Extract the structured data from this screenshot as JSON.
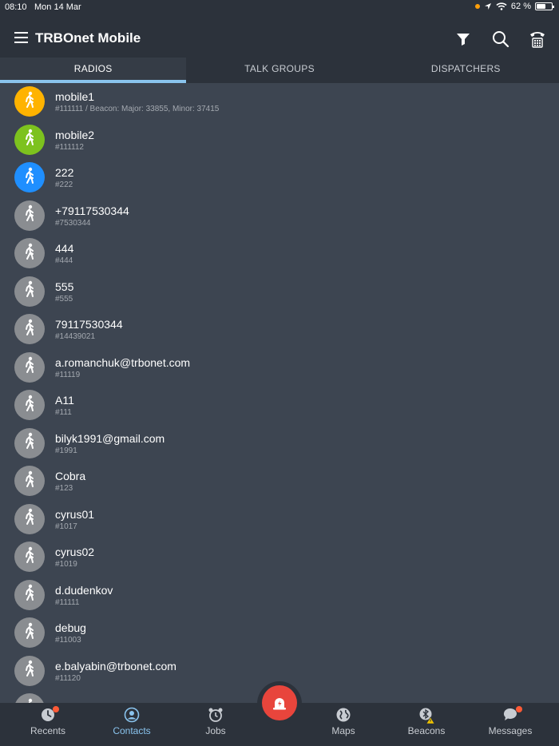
{
  "status_bar": {
    "time": "08:10",
    "date": "Mon 14 Mar",
    "battery": "62 %",
    "battery_level": 0.62
  },
  "header": {
    "title": "TRBOnet Mobile",
    "icons": [
      "menu-icon",
      "filter-icon",
      "search-icon",
      "phone-icon"
    ]
  },
  "tabs": [
    {
      "label": "RADIOS",
      "active": true
    },
    {
      "label": "TALK GROUPS",
      "active": false
    },
    {
      "label": "DISPATCHERS",
      "active": false
    }
  ],
  "radios": [
    {
      "name": "mobile1",
      "sub": "#111111 / Beacon: Major: 33855, Minor: 37415",
      "color": "#ffb300"
    },
    {
      "name": "mobile2",
      "sub": "#111112",
      "color": "#7dc21e"
    },
    {
      "name": "222",
      "sub": "#222",
      "color": "#1f8fff"
    },
    {
      "name": "+79117530344",
      "sub": "#7530344",
      "color": "#8a8d91"
    },
    {
      "name": "444",
      "sub": "#444",
      "color": "#8a8d91"
    },
    {
      "name": "555",
      "sub": "#555",
      "color": "#8a8d91"
    },
    {
      "name": "79117530344",
      "sub": "#14439021",
      "color": "#8a8d91"
    },
    {
      "name": "a.romanchuk@trbonet.com",
      "sub": "#11119",
      "color": "#8a8d91"
    },
    {
      "name": "A11",
      "sub": "#111",
      "color": "#8a8d91"
    },
    {
      "name": "bilyk1991@gmail.com",
      "sub": "#1991",
      "color": "#8a8d91"
    },
    {
      "name": "Cobra",
      "sub": "#123",
      "color": "#8a8d91"
    },
    {
      "name": "cyrus01",
      "sub": "#1017",
      "color": "#8a8d91"
    },
    {
      "name": "cyrus02",
      "sub": "#1019",
      "color": "#8a8d91"
    },
    {
      "name": "d.dudenkov",
      "sub": "#11111",
      "color": "#8a8d91"
    },
    {
      "name": "debug",
      "sub": "#11003",
      "color": "#8a8d91"
    },
    {
      "name": "e.balyabin@trbonet.com",
      "sub": "#11120",
      "color": "#8a8d91"
    },
    {
      "name": "",
      "sub": "",
      "color": "#8a8d91"
    }
  ],
  "bottom_nav": [
    {
      "label": "Recents",
      "icon": "recents-icon",
      "badge": true,
      "active": false
    },
    {
      "label": "Contacts",
      "icon": "contacts-icon",
      "badge": false,
      "active": true
    },
    {
      "label": "Jobs",
      "icon": "alarm-clock-icon",
      "badge": false,
      "active": false
    },
    {
      "label": "Maps",
      "icon": "globe-icon",
      "badge": false,
      "active": false
    },
    {
      "label": "Beacons",
      "icon": "beacon-icon",
      "badge": false,
      "active": false
    },
    {
      "label": "Messages",
      "icon": "chat-bubble-icon",
      "badge": true,
      "active": false
    }
  ],
  "alarm_button": {
    "icon": "emergency-alarm-icon",
    "color": "#e8453c"
  }
}
